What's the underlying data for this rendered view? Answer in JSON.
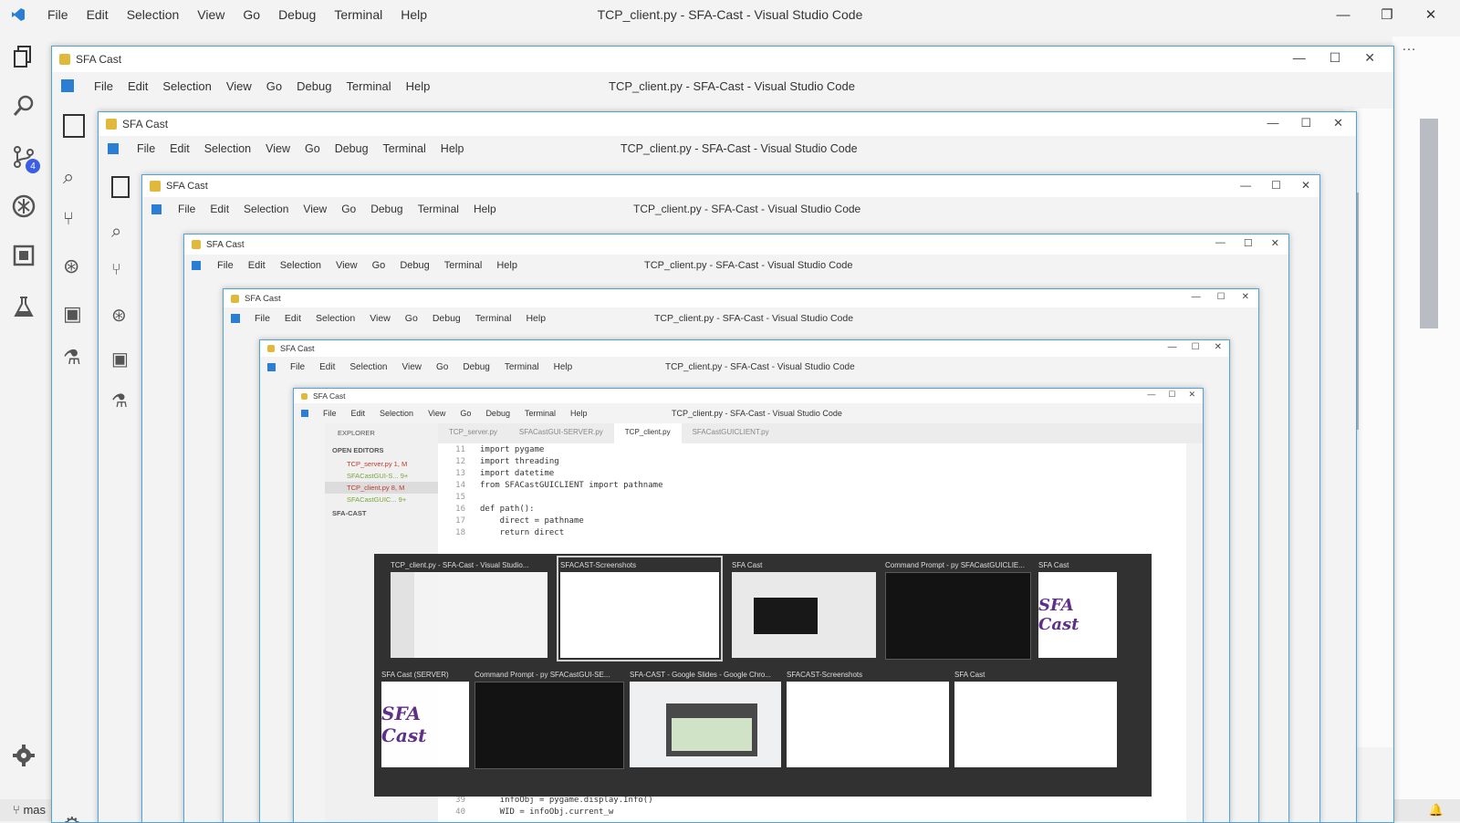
{
  "outer": {
    "title": "TCP_client.py - SFA-Cast - Visual Studio Code",
    "menu": [
      "File",
      "Edit",
      "Selection",
      "View",
      "Go",
      "Debug",
      "Terminal",
      "Help"
    ],
    "git_badge": "4",
    "status_branch": "mas"
  },
  "sfa_window": {
    "title": "SFA Cast",
    "vscode_title": "TCP_client.py - SFA-Cast - Visual Studio Code"
  },
  "editor": {
    "tabs": [
      "TCP_server.py",
      "SFACastGUI-SERVER.py",
      "TCP_client.py",
      "SFACastGUICLIENT.py"
    ],
    "explorer_label": "EXPLORER",
    "open_editors_label": "OPEN EDITORS",
    "open_editors": [
      "TCP_server.py 1, M",
      "SFACastGUI-S... 9+",
      "TCP_client.py 8, M",
      "SFACastGUIC... 9+"
    ],
    "project_label": "SFA-CAST",
    "code_lines": [
      {
        "n": "11",
        "text": "import pygame"
      },
      {
        "n": "12",
        "text": "import threading"
      },
      {
        "n": "13",
        "text": "import datetime"
      },
      {
        "n": "14",
        "text": "from SFACastGUICLIENT import pathname"
      },
      {
        "n": "15",
        "text": ""
      },
      {
        "n": "16",
        "text": "def path():"
      },
      {
        "n": "17",
        "text": "    direct = pathname"
      },
      {
        "n": "18",
        "text": "    return direct"
      }
    ],
    "bottom_lines": [
      {
        "n": "39",
        "text": "    infoObj = pygame.display.Info()"
      },
      {
        "n": "40",
        "text": "    WID = infoObj.current_w"
      }
    ]
  },
  "alt_tab": {
    "items": [
      {
        "label": "TCP_client.py - SFA-Cast - Visual Studio...",
        "kind": "vscode"
      },
      {
        "label": "SFACAST-Screenshots",
        "kind": "explorer"
      },
      {
        "label": "SFA Cast",
        "kind": "sfa-nested"
      },
      {
        "label": "Command Prompt - py SFACastGUICLIE...",
        "kind": "cmd"
      },
      {
        "label": "SFA Cast",
        "kind": "logo"
      },
      {
        "label": "SFA Cast (SERVER)",
        "kind": "logo"
      },
      {
        "label": "Command Prompt - py SFACastGUI-SE...",
        "kind": "cmd"
      },
      {
        "label": "SFA-CAST - Google Slides - Google Chro...",
        "kind": "slides"
      },
      {
        "label": "SFACAST-Screenshots",
        "kind": "explorer"
      },
      {
        "label": "SFA Cast",
        "kind": "explorer"
      }
    ],
    "logo_text": "SFA Cast"
  }
}
